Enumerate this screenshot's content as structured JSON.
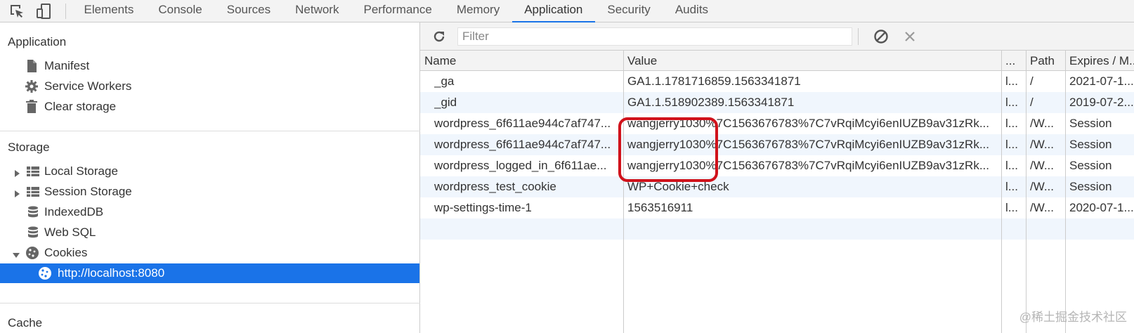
{
  "tabs": [
    "Elements",
    "Console",
    "Sources",
    "Network",
    "Performance",
    "Memory",
    "Application",
    "Security",
    "Audits"
  ],
  "active_tab": "Application",
  "sidebar": {
    "application": {
      "title": "Application",
      "items": [
        {
          "label": "Manifest",
          "icon": "document-icon"
        },
        {
          "label": "Service Workers",
          "icon": "gear-icon"
        },
        {
          "label": "Clear storage",
          "icon": "trash-icon"
        }
      ]
    },
    "storage": {
      "title": "Storage",
      "items": [
        {
          "label": "Local Storage",
          "icon": "grid-icon",
          "expander": "collapsed"
        },
        {
          "label": "Session Storage",
          "icon": "grid-icon",
          "expander": "collapsed"
        },
        {
          "label": "IndexedDB",
          "icon": "database-icon"
        },
        {
          "label": "Web SQL",
          "icon": "database-icon"
        },
        {
          "label": "Cookies",
          "icon": "cookie-icon",
          "expander": "expanded"
        },
        {
          "label": "http://localhost:8080",
          "icon": "cookie-icon",
          "selected": true
        }
      ]
    },
    "cache": {
      "title": "Cache"
    }
  },
  "toolbar": {
    "filter_placeholder": "Filter",
    "icons": [
      "refresh-icon",
      "block-icon",
      "clear-icon"
    ]
  },
  "table": {
    "columns": [
      "Name",
      "Value",
      "...",
      "Path",
      "Expires / M..."
    ],
    "rows": [
      {
        "name": "_ga",
        "value": "GA1.1.1781716859.1563341871",
        "domain": "l...",
        "path": "/",
        "expires": "2021-07-1..."
      },
      {
        "name": "_gid",
        "value": "GA1.1.518902389.1563341871",
        "domain": "l...",
        "path": "/",
        "expires": "2019-07-2..."
      },
      {
        "name": "wordpress_6f611ae944c7af747...",
        "value": "wangjerry1030%7C1563676783%7C7vRqiMcyi6enIUZB9av31zRk...",
        "domain": "l...",
        "path": "/W...",
        "expires": "Session"
      },
      {
        "name": "wordpress_6f611ae944c7af747...",
        "value": "wangjerry1030%7C1563676783%7C7vRqiMcyi6enIUZB9av31zRk...",
        "domain": "l...",
        "path": "/W...",
        "expires": "Session"
      },
      {
        "name": "wordpress_logged_in_6f611ae...",
        "value": "wangjerry1030%7C1563676783%7C7vRqiMcyi6enIUZB9av31zRk...",
        "domain": "l...",
        "path": "/W...",
        "expires": "Session"
      },
      {
        "name": "wordpress_test_cookie",
        "value": "WP+Cookie+check",
        "domain": "l...",
        "path": "/W...",
        "expires": "Session"
      },
      {
        "name": "wp-settings-time-1",
        "value": "1563516911",
        "domain": "l...",
        "path": "/W...",
        "expires": "2020-07-1..."
      }
    ]
  },
  "watermark": "@稀土掘金技术社区",
  "colors": {
    "accent": "#1a73e8",
    "highlight": "#d0121b",
    "row_alt": "#f0f6fd"
  }
}
